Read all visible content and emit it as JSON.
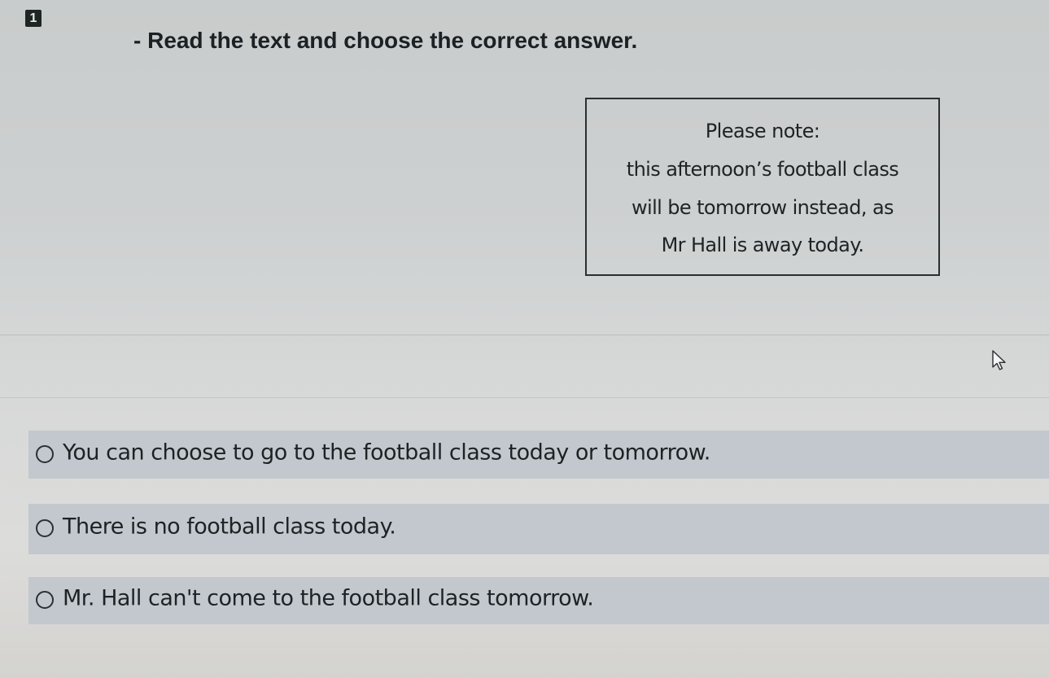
{
  "question": {
    "number": "1",
    "instruction": "- Read the text and choose the correct answer."
  },
  "notice": {
    "lines": [
      "Please note:",
      "this afternoon’s football class",
      "will be tomorrow instead, as",
      "Mr Hall is away today."
    ]
  },
  "options": [
    {
      "label": "You can choose to go to the football class today or tomorrow.",
      "selected": false
    },
    {
      "label": "There is no football class today.",
      "selected": false
    },
    {
      "label": "Mr. Hall can't come to the football class tomorrow.",
      "selected": false
    }
  ],
  "icons": {
    "cursor": "mouse-pointer-icon",
    "radio": "radio-unchecked-icon"
  }
}
